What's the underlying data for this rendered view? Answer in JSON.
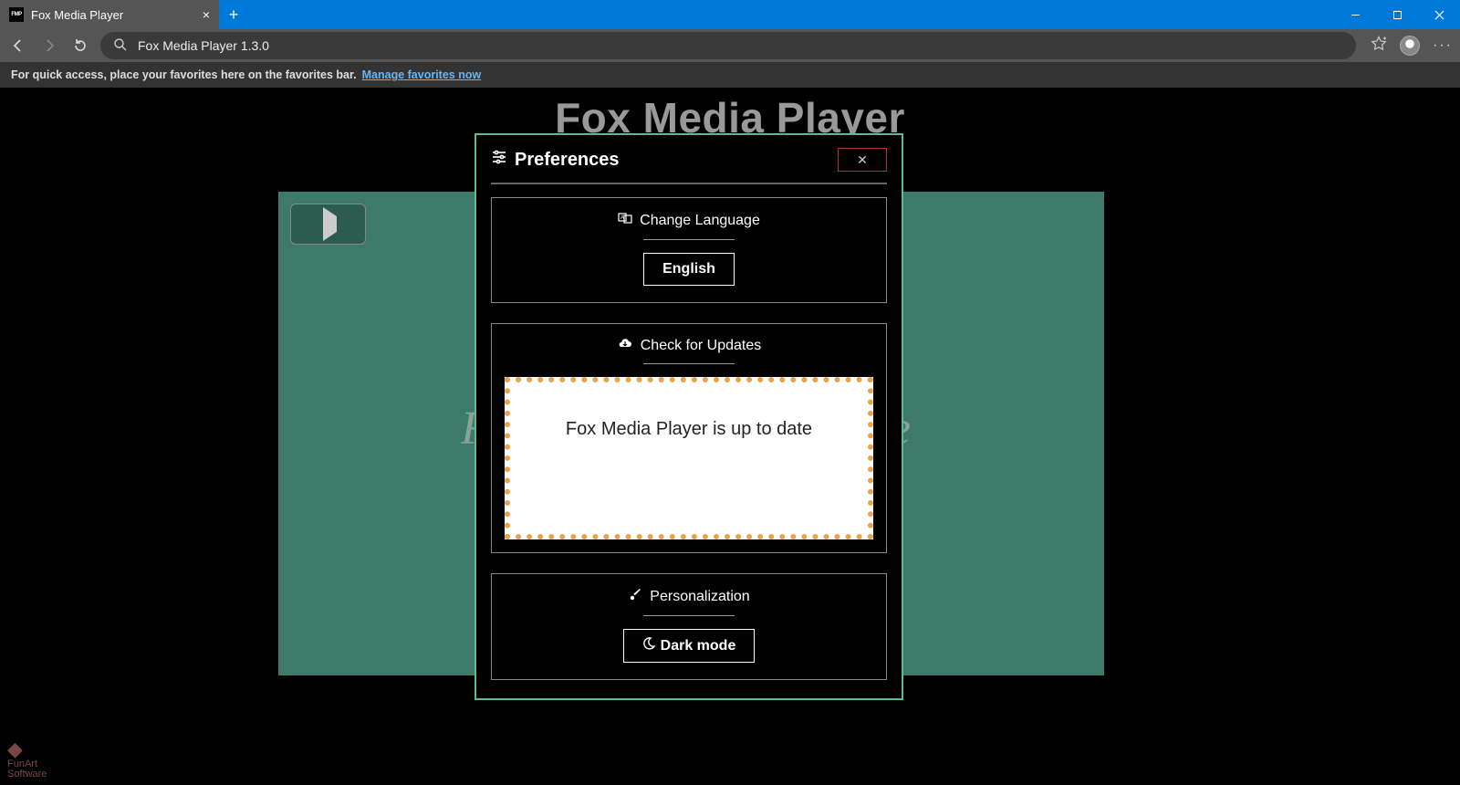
{
  "browser": {
    "tab_title": "Fox Media Player",
    "tab_favicon_text": "FMP",
    "address_text": "Fox Media Player 1.3.0",
    "favbar_text": "For quick access, place your favorites here on the favorites bar.",
    "favbar_link": "Manage favorites now"
  },
  "app": {
    "title": "Fox Media Player",
    "background_hint_left": "F",
    "background_hint_right": "e"
  },
  "modal": {
    "title": "Preferences",
    "close_glyph": "✕",
    "sections": {
      "language": {
        "label": "Change Language",
        "value": "English"
      },
      "updates": {
        "label": "Check for Updates",
        "status": "Fox Media Player is up to date"
      },
      "personalization": {
        "label": "Personalization",
        "mode_label": "Dark mode"
      }
    }
  },
  "footer": {
    "logo_text": "FunArt\nSoftware"
  }
}
